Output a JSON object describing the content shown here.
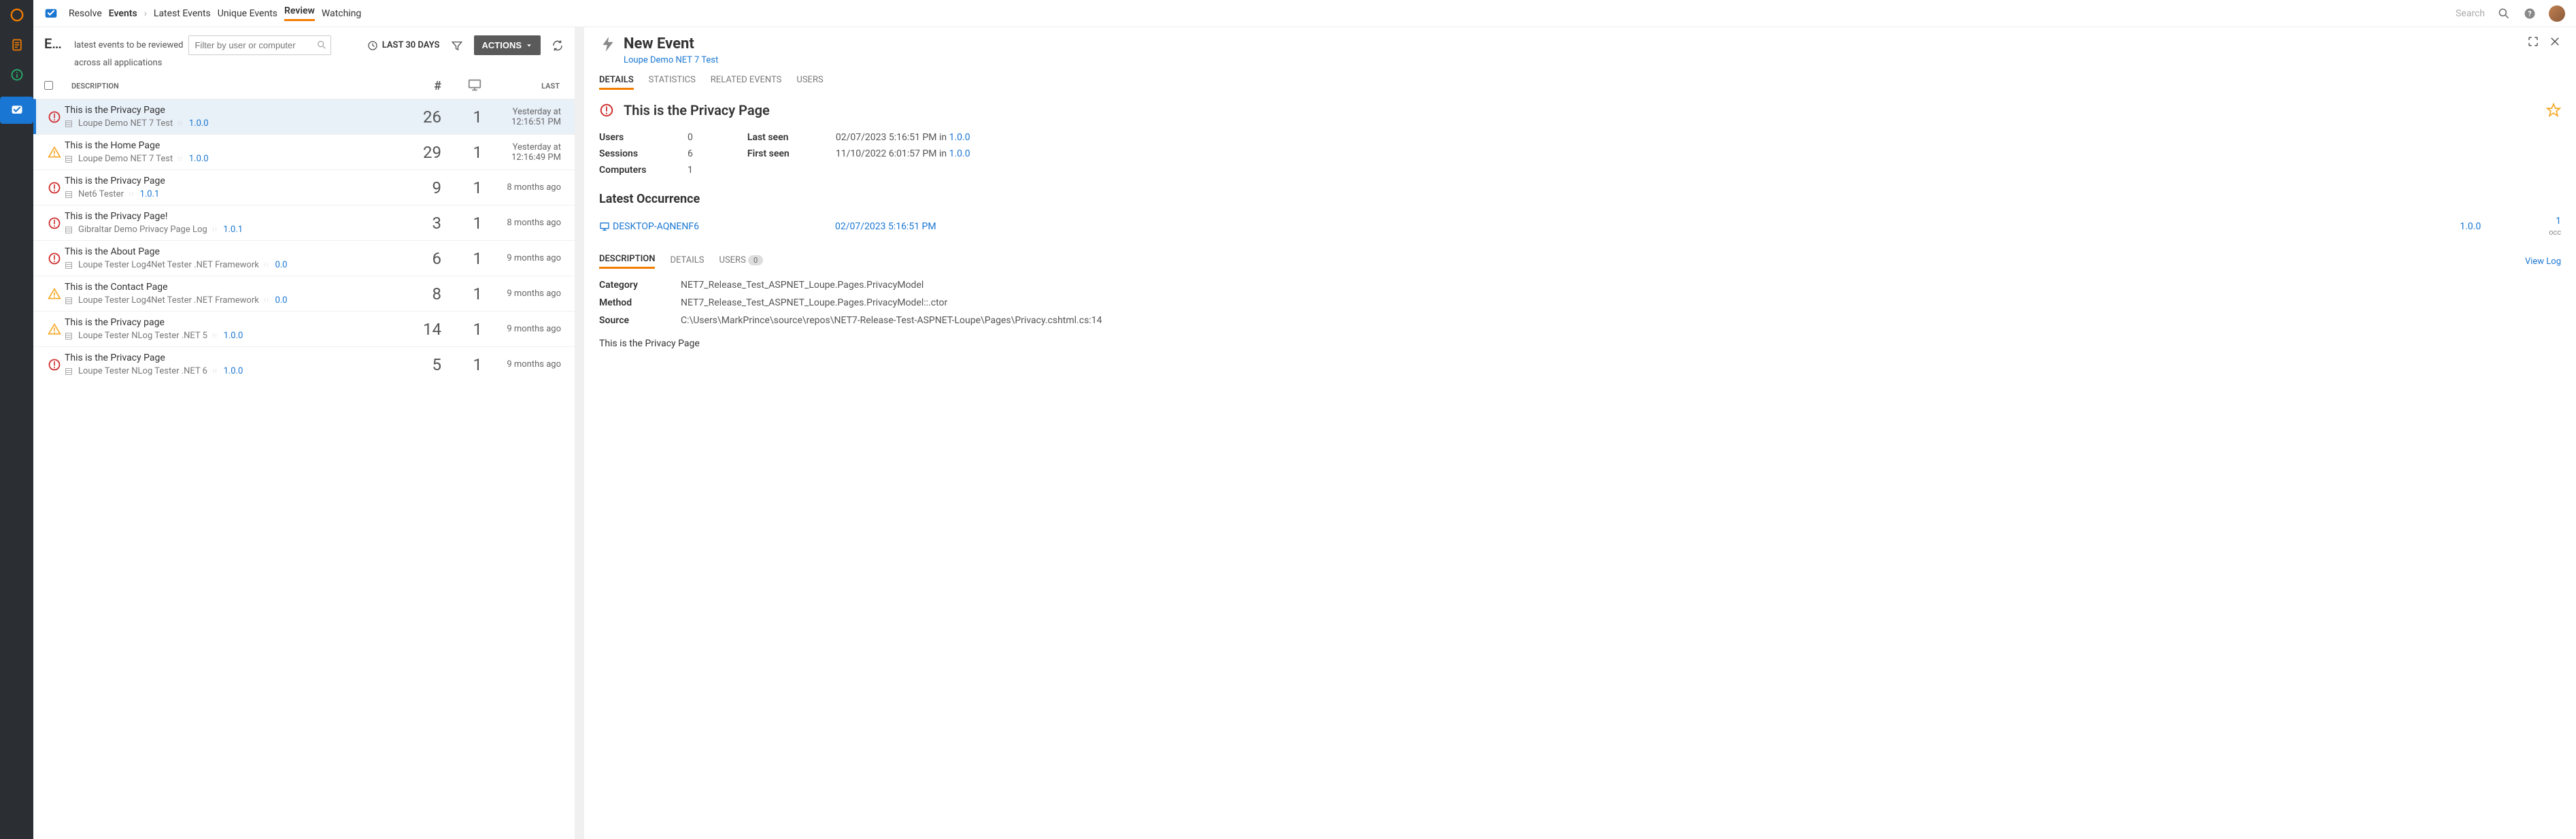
{
  "topbar": {
    "resolve": "Resolve",
    "events": "Events",
    "latest_events": "Latest Events",
    "unique_events": "Unique Events",
    "review": "Review",
    "watching": "Watching",
    "search_placeholder": "Search"
  },
  "left": {
    "title": "E…",
    "subtitle1": "latest events to be reviewed",
    "subtitle2": "across all applications",
    "filter_placeholder": "Filter by user or computer",
    "timerange": "LAST 30 DAYS",
    "actions": "ACTIONS",
    "cols": {
      "desc": "DESCRIPTION",
      "count": "#",
      "last": "LAST"
    }
  },
  "rows": [
    {
      "sev": "error",
      "title": "This is the Privacy Page",
      "app": "Loupe Demo NET 7 Test",
      "version": "1.0.0",
      "count": "26",
      "computers": "1",
      "last1": "Yesterday at",
      "last2": "12:16:51 PM",
      "selected": true
    },
    {
      "sev": "warn",
      "title": "This is the Home Page",
      "app": "Loupe Demo NET 7 Test",
      "version": "1.0.0",
      "count": "29",
      "computers": "1",
      "last1": "Yesterday at",
      "last2": "12:16:49 PM"
    },
    {
      "sev": "error",
      "title": "This is the Privacy Page",
      "app": "Net6 Tester",
      "version": "1.0.1",
      "count": "9",
      "computers": "1",
      "last1": "8 months ago",
      "last2": ""
    },
    {
      "sev": "error",
      "title": "This is the Privacy Page!",
      "app": "Gibraltar Demo Privacy Page Log",
      "version": "1.0.1",
      "count": "3",
      "computers": "1",
      "last1": "8 months ago",
      "last2": ""
    },
    {
      "sev": "error",
      "title": "This is the About Page",
      "app": "Loupe Tester Log4Net Tester .NET Framework",
      "version": "0.0",
      "count": "6",
      "computers": "1",
      "last1": "9 months ago",
      "last2": ""
    },
    {
      "sev": "warn",
      "title": "This is the Contact Page",
      "app": "Loupe Tester Log4Net Tester .NET Framework",
      "version": "0.0",
      "count": "8",
      "computers": "1",
      "last1": "9 months ago",
      "last2": ""
    },
    {
      "sev": "warn",
      "title": "This is the Privacy page",
      "app": "Loupe Tester NLog Tester .NET 5",
      "version": "1.0.0",
      "count": "14",
      "computers": "1",
      "last1": "9 months ago",
      "last2": ""
    },
    {
      "sev": "error",
      "title": "This is the Privacy Page",
      "app": "Loupe Tester NLog Tester .NET 6",
      "version": "1.0.0",
      "count": "5",
      "computers": "1",
      "last1": "9 months ago",
      "last2": ""
    }
  ],
  "right": {
    "header": "New Event",
    "app_link": "Loupe Demo NET 7 Test",
    "tabs": {
      "details": "DETAILS",
      "statistics": "STATISTICS",
      "related": "RELATED EVENTS",
      "users": "USERS"
    },
    "title": "This is the Privacy Page",
    "stats": {
      "users_label": "Users",
      "users_val": "0",
      "sessions_label": "Sessions",
      "sessions_val": "6",
      "computers_label": "Computers",
      "computers_val": "1",
      "lastseen_label": "Last seen",
      "lastseen_val": "02/07/2023 5:16:51 PM in ",
      "lastseen_ver": "1.0.0",
      "firstseen_label": "First seen",
      "firstseen_val": "11/10/2022 6:01:57 PM in ",
      "firstseen_ver": "1.0.0"
    },
    "latest_occurrence": "Latest Occurrence",
    "occurrence": {
      "computer": "DESKTOP-AQNENF6",
      "timestamp": "02/07/2023 5:16:51 PM",
      "version": "1.0.0",
      "occ_count": "1",
      "occ_label": "occ"
    },
    "subtabs": {
      "desc": "DESCRIPTION",
      "details": "DETAILS",
      "users": "USERS",
      "users_badge": "0",
      "view_log": "View Log"
    },
    "kv": {
      "category_k": "Category",
      "category_v": "NET7_Release_Test_ASPNET_Loupe.Pages.PrivacyModel",
      "method_k": "Method",
      "method_v": "NET7_Release_Test_ASPNET_Loupe.Pages.PrivacyModel::.ctor",
      "source_k": "Source",
      "source_v": "C:\\Users\\MarkPrince\\source\\repos\\NET7-Release-Test-ASPNET-Loupe\\Pages\\Privacy.cshtml.cs:14"
    },
    "desc_text": "This is the Privacy Page"
  }
}
